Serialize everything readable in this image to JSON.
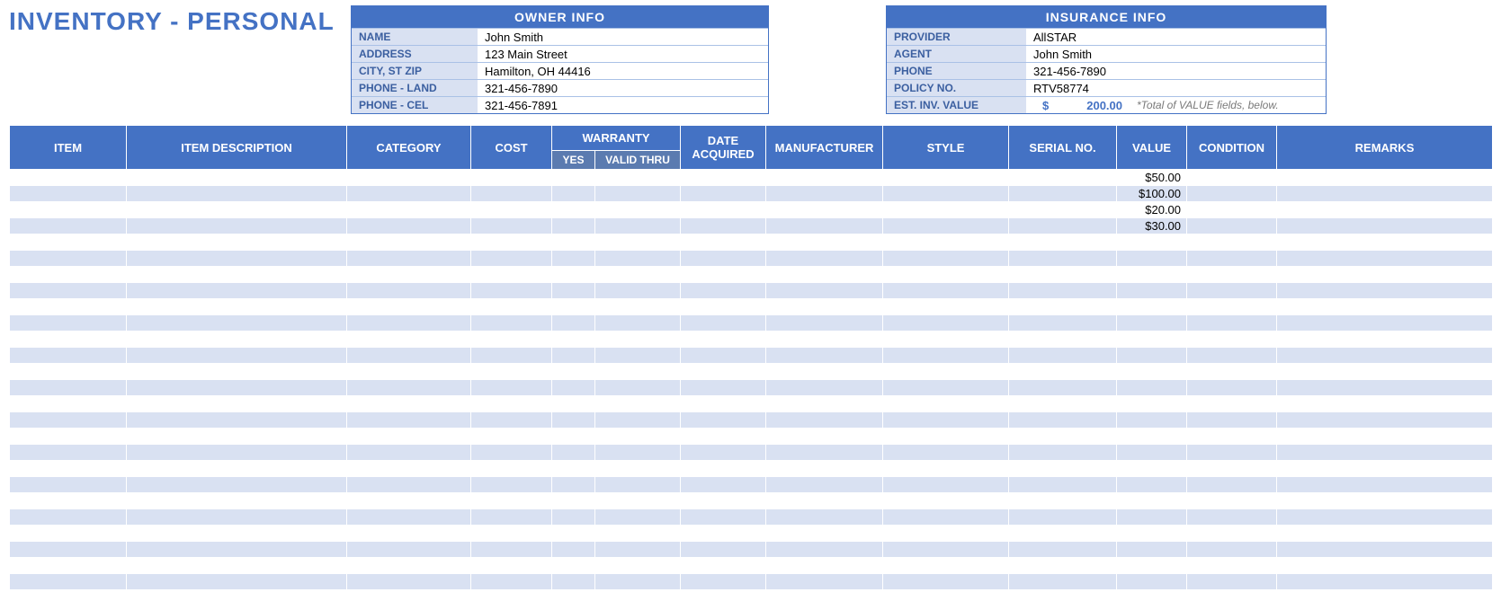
{
  "title": "INVENTORY - PERSONAL",
  "owner_info": {
    "header": "OWNER INFO",
    "rows": [
      {
        "label": "NAME",
        "value": "John Smith"
      },
      {
        "label": "ADDRESS",
        "value": "123 Main Street"
      },
      {
        "label": "CITY, ST  ZIP",
        "value": "Hamilton, OH  44416"
      },
      {
        "label": "PHONE - LAND",
        "value": "321-456-7890"
      },
      {
        "label": "PHONE - CEL",
        "value": "321-456-7891"
      }
    ]
  },
  "insurance_info": {
    "header": "INSURANCE INFO",
    "rows": [
      {
        "label": "PROVIDER",
        "value": "AllSTAR"
      },
      {
        "label": "AGENT",
        "value": "John Smith"
      },
      {
        "label": "PHONE",
        "value": "321-456-7890"
      },
      {
        "label": "POLICY NO.",
        "value": "RTV58774"
      }
    ],
    "est_inv_label": "EST. INV. VALUE",
    "est_inv_currency": "$",
    "est_inv_amount": "200.00",
    "est_inv_note": "*Total of VALUE fields, below."
  },
  "columns": {
    "item": "ITEM",
    "desc": "ITEM DESCRIPTION",
    "category": "CATEGORY",
    "cost": "COST",
    "warranty": "WARRANTY",
    "warranty_yes": "YES",
    "warranty_valid": "VALID THRU",
    "date_acq": "DATE ACQUIRED",
    "manufacturer": "MANUFACTURER",
    "style": "STYLE",
    "serial": "SERIAL NO.",
    "value": "VALUE",
    "condition": "CONDITION",
    "remarks": "REMARKS"
  },
  "rows": [
    {
      "item": "",
      "desc": "",
      "category": "",
      "cost": "",
      "wyes": "",
      "wthru": "",
      "date": "",
      "mfr": "",
      "style": "",
      "serial": "",
      "value": "$50.00",
      "cond": "",
      "remarks": ""
    },
    {
      "item": "",
      "desc": "",
      "category": "",
      "cost": "",
      "wyes": "",
      "wthru": "",
      "date": "",
      "mfr": "",
      "style": "",
      "serial": "",
      "value": "$100.00",
      "cond": "",
      "remarks": ""
    },
    {
      "item": "",
      "desc": "",
      "category": "",
      "cost": "",
      "wyes": "",
      "wthru": "",
      "date": "",
      "mfr": "",
      "style": "",
      "serial": "",
      "value": "$20.00",
      "cond": "",
      "remarks": ""
    },
    {
      "item": "",
      "desc": "",
      "category": "",
      "cost": "",
      "wyes": "",
      "wthru": "",
      "date": "",
      "mfr": "",
      "style": "",
      "serial": "",
      "value": "$30.00",
      "cond": "",
      "remarks": ""
    },
    {
      "item": "",
      "desc": "",
      "category": "",
      "cost": "",
      "wyes": "",
      "wthru": "",
      "date": "",
      "mfr": "",
      "style": "",
      "serial": "",
      "value": "",
      "cond": "",
      "remarks": ""
    },
    {
      "item": "",
      "desc": "",
      "category": "",
      "cost": "",
      "wyes": "",
      "wthru": "",
      "date": "",
      "mfr": "",
      "style": "",
      "serial": "",
      "value": "",
      "cond": "",
      "remarks": ""
    },
    {
      "item": "",
      "desc": "",
      "category": "",
      "cost": "",
      "wyes": "",
      "wthru": "",
      "date": "",
      "mfr": "",
      "style": "",
      "serial": "",
      "value": "",
      "cond": "",
      "remarks": ""
    },
    {
      "item": "",
      "desc": "",
      "category": "",
      "cost": "",
      "wyes": "",
      "wthru": "",
      "date": "",
      "mfr": "",
      "style": "",
      "serial": "",
      "value": "",
      "cond": "",
      "remarks": ""
    },
    {
      "item": "",
      "desc": "",
      "category": "",
      "cost": "",
      "wyes": "",
      "wthru": "",
      "date": "",
      "mfr": "",
      "style": "",
      "serial": "",
      "value": "",
      "cond": "",
      "remarks": ""
    },
    {
      "item": "",
      "desc": "",
      "category": "",
      "cost": "",
      "wyes": "",
      "wthru": "",
      "date": "",
      "mfr": "",
      "style": "",
      "serial": "",
      "value": "",
      "cond": "",
      "remarks": ""
    },
    {
      "item": "",
      "desc": "",
      "category": "",
      "cost": "",
      "wyes": "",
      "wthru": "",
      "date": "",
      "mfr": "",
      "style": "",
      "serial": "",
      "value": "",
      "cond": "",
      "remarks": ""
    },
    {
      "item": "",
      "desc": "",
      "category": "",
      "cost": "",
      "wyes": "",
      "wthru": "",
      "date": "",
      "mfr": "",
      "style": "",
      "serial": "",
      "value": "",
      "cond": "",
      "remarks": ""
    },
    {
      "item": "",
      "desc": "",
      "category": "",
      "cost": "",
      "wyes": "",
      "wthru": "",
      "date": "",
      "mfr": "",
      "style": "",
      "serial": "",
      "value": "",
      "cond": "",
      "remarks": ""
    },
    {
      "item": "",
      "desc": "",
      "category": "",
      "cost": "",
      "wyes": "",
      "wthru": "",
      "date": "",
      "mfr": "",
      "style": "",
      "serial": "",
      "value": "",
      "cond": "",
      "remarks": ""
    },
    {
      "item": "",
      "desc": "",
      "category": "",
      "cost": "",
      "wyes": "",
      "wthru": "",
      "date": "",
      "mfr": "",
      "style": "",
      "serial": "",
      "value": "",
      "cond": "",
      "remarks": ""
    },
    {
      "item": "",
      "desc": "",
      "category": "",
      "cost": "",
      "wyes": "",
      "wthru": "",
      "date": "",
      "mfr": "",
      "style": "",
      "serial": "",
      "value": "",
      "cond": "",
      "remarks": ""
    },
    {
      "item": "",
      "desc": "",
      "category": "",
      "cost": "",
      "wyes": "",
      "wthru": "",
      "date": "",
      "mfr": "",
      "style": "",
      "serial": "",
      "value": "",
      "cond": "",
      "remarks": ""
    },
    {
      "item": "",
      "desc": "",
      "category": "",
      "cost": "",
      "wyes": "",
      "wthru": "",
      "date": "",
      "mfr": "",
      "style": "",
      "serial": "",
      "value": "",
      "cond": "",
      "remarks": ""
    },
    {
      "item": "",
      "desc": "",
      "category": "",
      "cost": "",
      "wyes": "",
      "wthru": "",
      "date": "",
      "mfr": "",
      "style": "",
      "serial": "",
      "value": "",
      "cond": "",
      "remarks": ""
    },
    {
      "item": "",
      "desc": "",
      "category": "",
      "cost": "",
      "wyes": "",
      "wthru": "",
      "date": "",
      "mfr": "",
      "style": "",
      "serial": "",
      "value": "",
      "cond": "",
      "remarks": ""
    },
    {
      "item": "",
      "desc": "",
      "category": "",
      "cost": "",
      "wyes": "",
      "wthru": "",
      "date": "",
      "mfr": "",
      "style": "",
      "serial": "",
      "value": "",
      "cond": "",
      "remarks": ""
    },
    {
      "item": "",
      "desc": "",
      "category": "",
      "cost": "",
      "wyes": "",
      "wthru": "",
      "date": "",
      "mfr": "",
      "style": "",
      "serial": "",
      "value": "",
      "cond": "",
      "remarks": ""
    },
    {
      "item": "",
      "desc": "",
      "category": "",
      "cost": "",
      "wyes": "",
      "wthru": "",
      "date": "",
      "mfr": "",
      "style": "",
      "serial": "",
      "value": "",
      "cond": "",
      "remarks": ""
    },
    {
      "item": "",
      "desc": "",
      "category": "",
      "cost": "",
      "wyes": "",
      "wthru": "",
      "date": "",
      "mfr": "",
      "style": "",
      "serial": "",
      "value": "",
      "cond": "",
      "remarks": ""
    },
    {
      "item": "",
      "desc": "",
      "category": "",
      "cost": "",
      "wyes": "",
      "wthru": "",
      "date": "",
      "mfr": "",
      "style": "",
      "serial": "",
      "value": "",
      "cond": "",
      "remarks": ""
    },
    {
      "item": "",
      "desc": "",
      "category": "",
      "cost": "",
      "wyes": "",
      "wthru": "",
      "date": "",
      "mfr": "",
      "style": "",
      "serial": "",
      "value": "",
      "cond": "",
      "remarks": ""
    }
  ]
}
